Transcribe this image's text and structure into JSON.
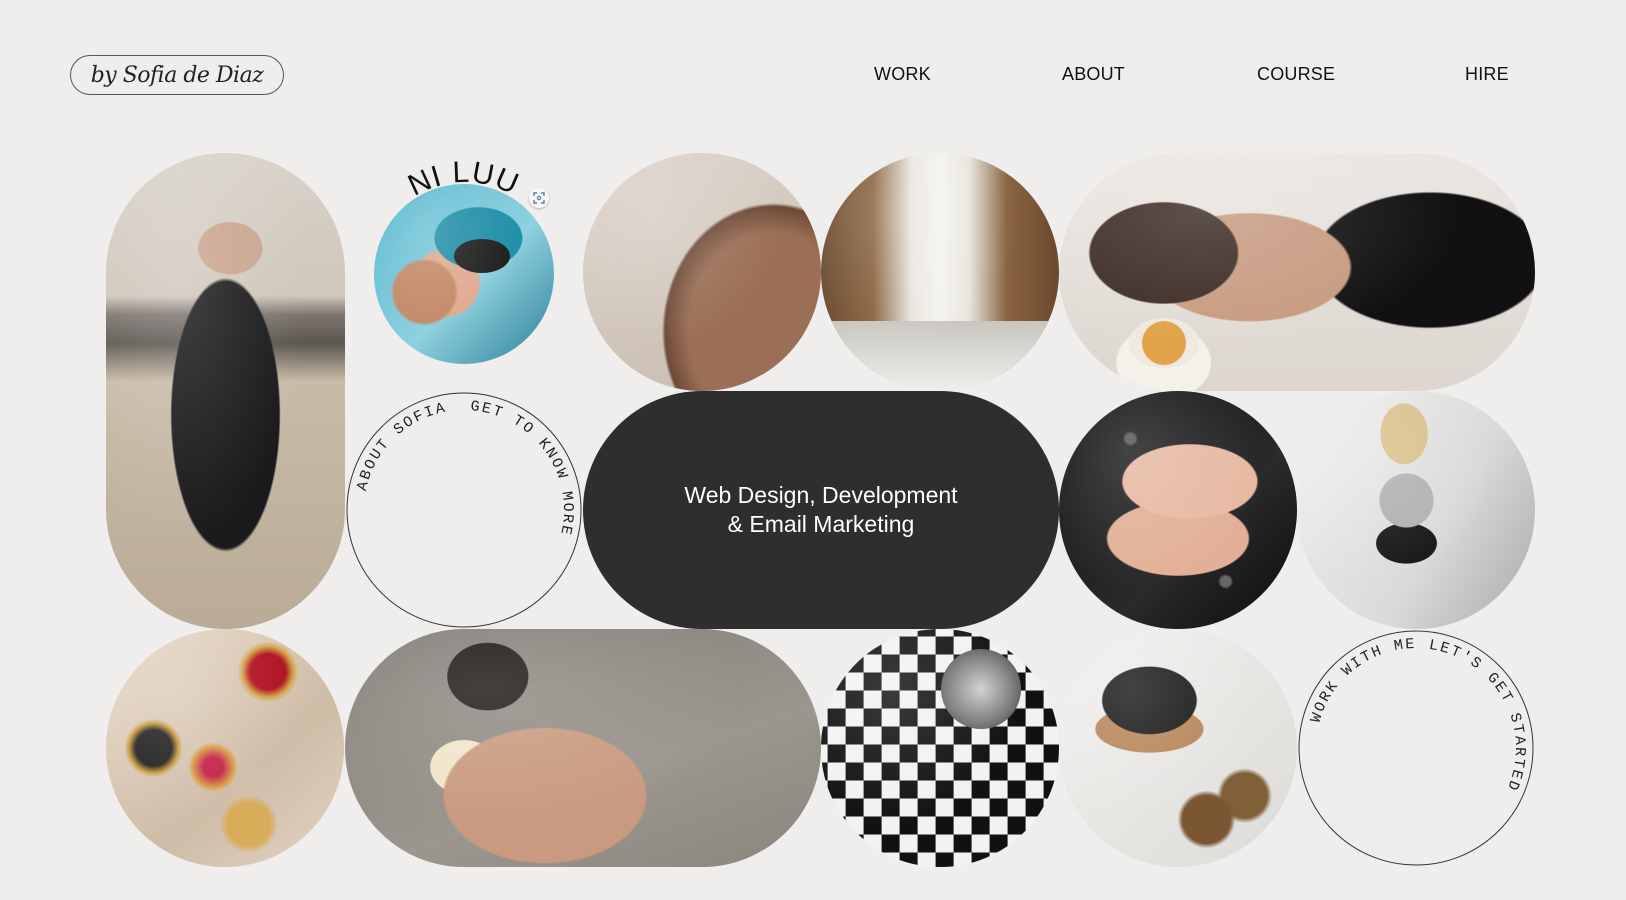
{
  "logo": {
    "text": "by Sofia de Diaz"
  },
  "nav": [
    {
      "label": "WORK"
    },
    {
      "label": "ABOUT"
    },
    {
      "label": "COURSE"
    },
    {
      "label": "HIRE"
    }
  ],
  "niluu": {
    "label": "NI LUU"
  },
  "about_ring": {
    "top_text": "ABOUT SOFIA",
    "right_text": "GET TO KNOW MORE"
  },
  "cta": {
    "line1": "Web Design, Development",
    "line2": "& Email Marketing"
  },
  "work_ring": {
    "top_text": "WORK WITH ME",
    "right_text": "LET'S GET STARTED"
  },
  "colors": {
    "background": "#efeeec",
    "dark_pill": "#2e2e2e",
    "text": "#111111"
  },
  "icons": {
    "expand": "expand-icon"
  }
}
